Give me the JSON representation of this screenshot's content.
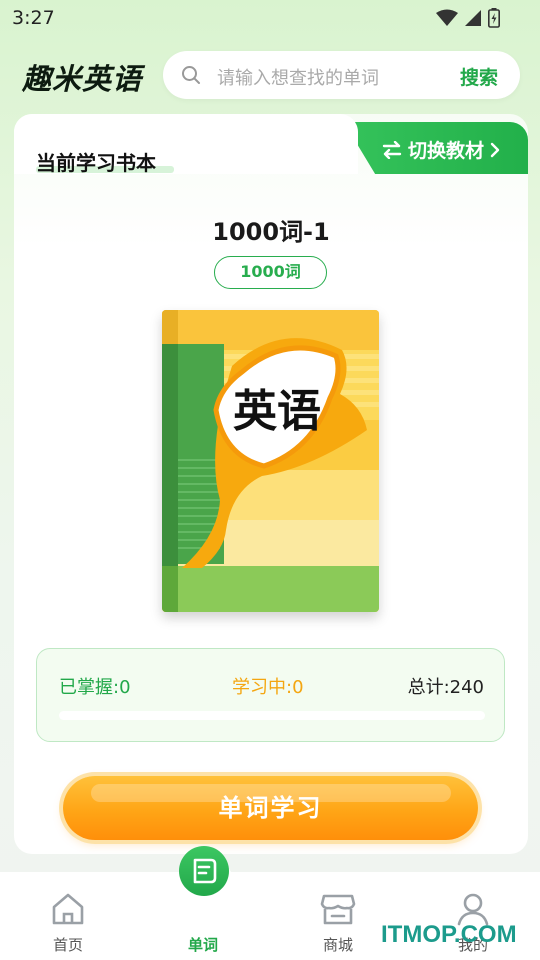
{
  "status_bar": {
    "time": "3:27",
    "icons": [
      "wifi-icon",
      "cell-signal-icon",
      "battery-icon"
    ]
  },
  "header": {
    "brand": "趣米英语",
    "search": {
      "placeholder": "请输入想查找的单词",
      "button_label": "搜索"
    }
  },
  "card": {
    "title": "当前学习书本",
    "switch_label": "切换教材",
    "book": {
      "name": "1000词-1",
      "badge": "1000词",
      "cover_text": "英语"
    },
    "stats": {
      "mastered": "已掌握:0",
      "learning": "学习中:0",
      "total": "总计:240",
      "progress": 0
    },
    "study_button": "单词学习"
  },
  "bottom_nav": {
    "items": [
      {
        "label": "首页",
        "icon": "home-icon",
        "active": false
      },
      {
        "label": "单词",
        "icon": "word-book-icon",
        "active": true
      },
      {
        "label": "商城",
        "icon": "store-icon",
        "active": false
      },
      {
        "label": "我的",
        "icon": "profile-icon",
        "active": false
      }
    ]
  },
  "watermark": "ITMOP.COM",
  "colors": {
    "accent_green": "#22a84a",
    "accent_orange": "#ffa516",
    "learning_orange": "#f4a611"
  }
}
